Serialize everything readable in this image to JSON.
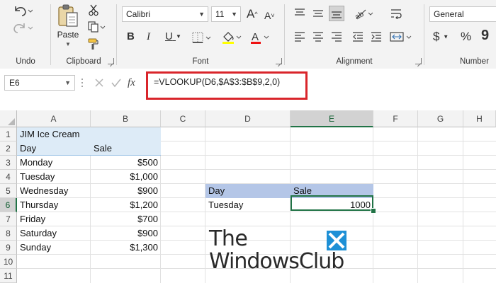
{
  "ribbon": {
    "groups": {
      "undo": "Undo",
      "clipboard": "Clipboard",
      "font": "Font",
      "alignment": "Alignment",
      "number": "Number"
    },
    "paste_label": "Paste",
    "font_name": "Calibri",
    "font_size": "11",
    "number_format": "General",
    "bold": "B",
    "italic": "I",
    "underline": "U",
    "grow_font": "A",
    "shrink_font": "A",
    "currency": "$",
    "percent": "%",
    "comma": "9"
  },
  "formula_bar": {
    "name_box": "E6",
    "fx": "fx",
    "formula": "=VLOOKUP(D6,$A$3:$B$9,2,0)"
  },
  "sheet": {
    "columns": [
      "A",
      "B",
      "C",
      "D",
      "E",
      "F",
      "G",
      "H"
    ],
    "active_column": "E",
    "rows": [
      "1",
      "2",
      "3",
      "4",
      "5",
      "6",
      "7",
      "8",
      "9",
      "10",
      "11"
    ],
    "active_row": "6",
    "cells": {
      "A1": "JIM Ice Cream",
      "A2": "Day",
      "B2": "Sale",
      "A3": "Monday",
      "B3": "$500",
      "A4": "Tuesday",
      "B4": "$1,000",
      "A5": "Wednesday",
      "B5": "$900",
      "A6": "Thursday",
      "B6": "$1,200",
      "A7": "Friday",
      "B7": "$700",
      "A8": "Saturday",
      "B8": "$900",
      "A9": "Sunday",
      "B9": "$1,300",
      "D5": "Day",
      "E5": "Sale",
      "D6": "Tuesday",
      "E6": "1000"
    },
    "colors": {
      "header_fill": "#ddebf7",
      "lookup_header_fill": "#b4c6e7",
      "selection": "#217346",
      "highlight": "#d9252b"
    }
  },
  "watermark": {
    "line1": "The",
    "line2": "WindowsClub"
  }
}
